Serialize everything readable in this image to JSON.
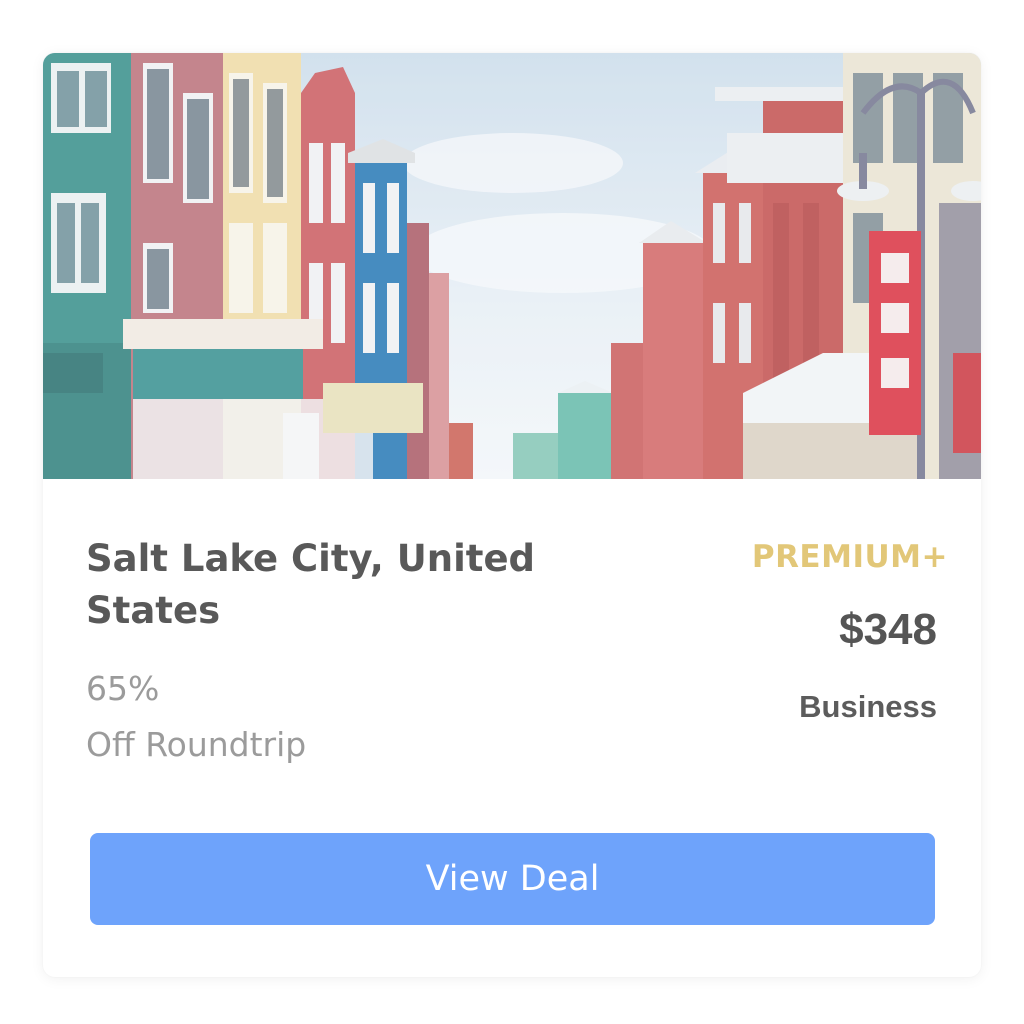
{
  "deal": {
    "title": "Salt Lake City, United States",
    "discount_percent": "65%",
    "discount_text": "Off Roundtrip",
    "tier": "PREMIUM+",
    "price": "$348",
    "cabin": "Business",
    "button_label": "View Deal"
  },
  "colors": {
    "tier": "#e2c778",
    "button": "#6ea3fb",
    "title": "#595959",
    "muted": "#9b9b9b"
  }
}
